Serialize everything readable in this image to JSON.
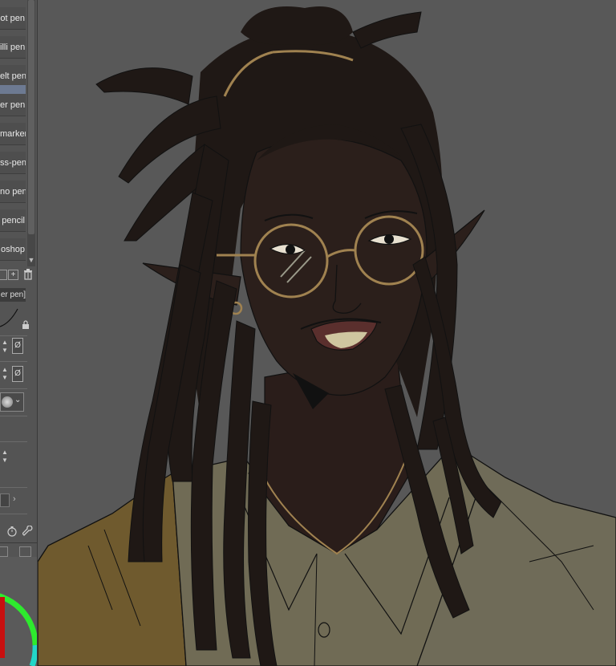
{
  "tools": [
    {
      "label": "ot pen",
      "active": false
    },
    {
      "label": "illi pen",
      "active": false
    },
    {
      "label": "elt pen",
      "active": false
    },
    {
      "label": "",
      "active": true
    },
    {
      "label": "er pen",
      "active": false
    },
    {
      "label": "marker",
      "active": false
    },
    {
      "label": "ss-pen",
      "active": false
    },
    {
      "label": "no pen",
      "active": false
    },
    {
      "label": "pencil",
      "active": false
    },
    {
      "label": "oshop",
      "active": false
    }
  ],
  "subtool_tab_label": "er pen]",
  "brush_size_reset": "Ø",
  "opacity_reset": "Ø",
  "colors": {
    "accent": "#6d7a92",
    "panel_bg": "#545454",
    "canvas_bg": "#585858",
    "color_wheel_ring": "#2eea2e",
    "color_wheel_inner": "#c80f0f"
  },
  "icons": [
    "copy-icon",
    "add-icon",
    "delete-icon",
    "lock-icon",
    "brush-preview-icon",
    "chevron-down-icon",
    "chevron-right-icon",
    "stopwatch-icon",
    "wrench-icon",
    "color-wheel-icon"
  ]
}
